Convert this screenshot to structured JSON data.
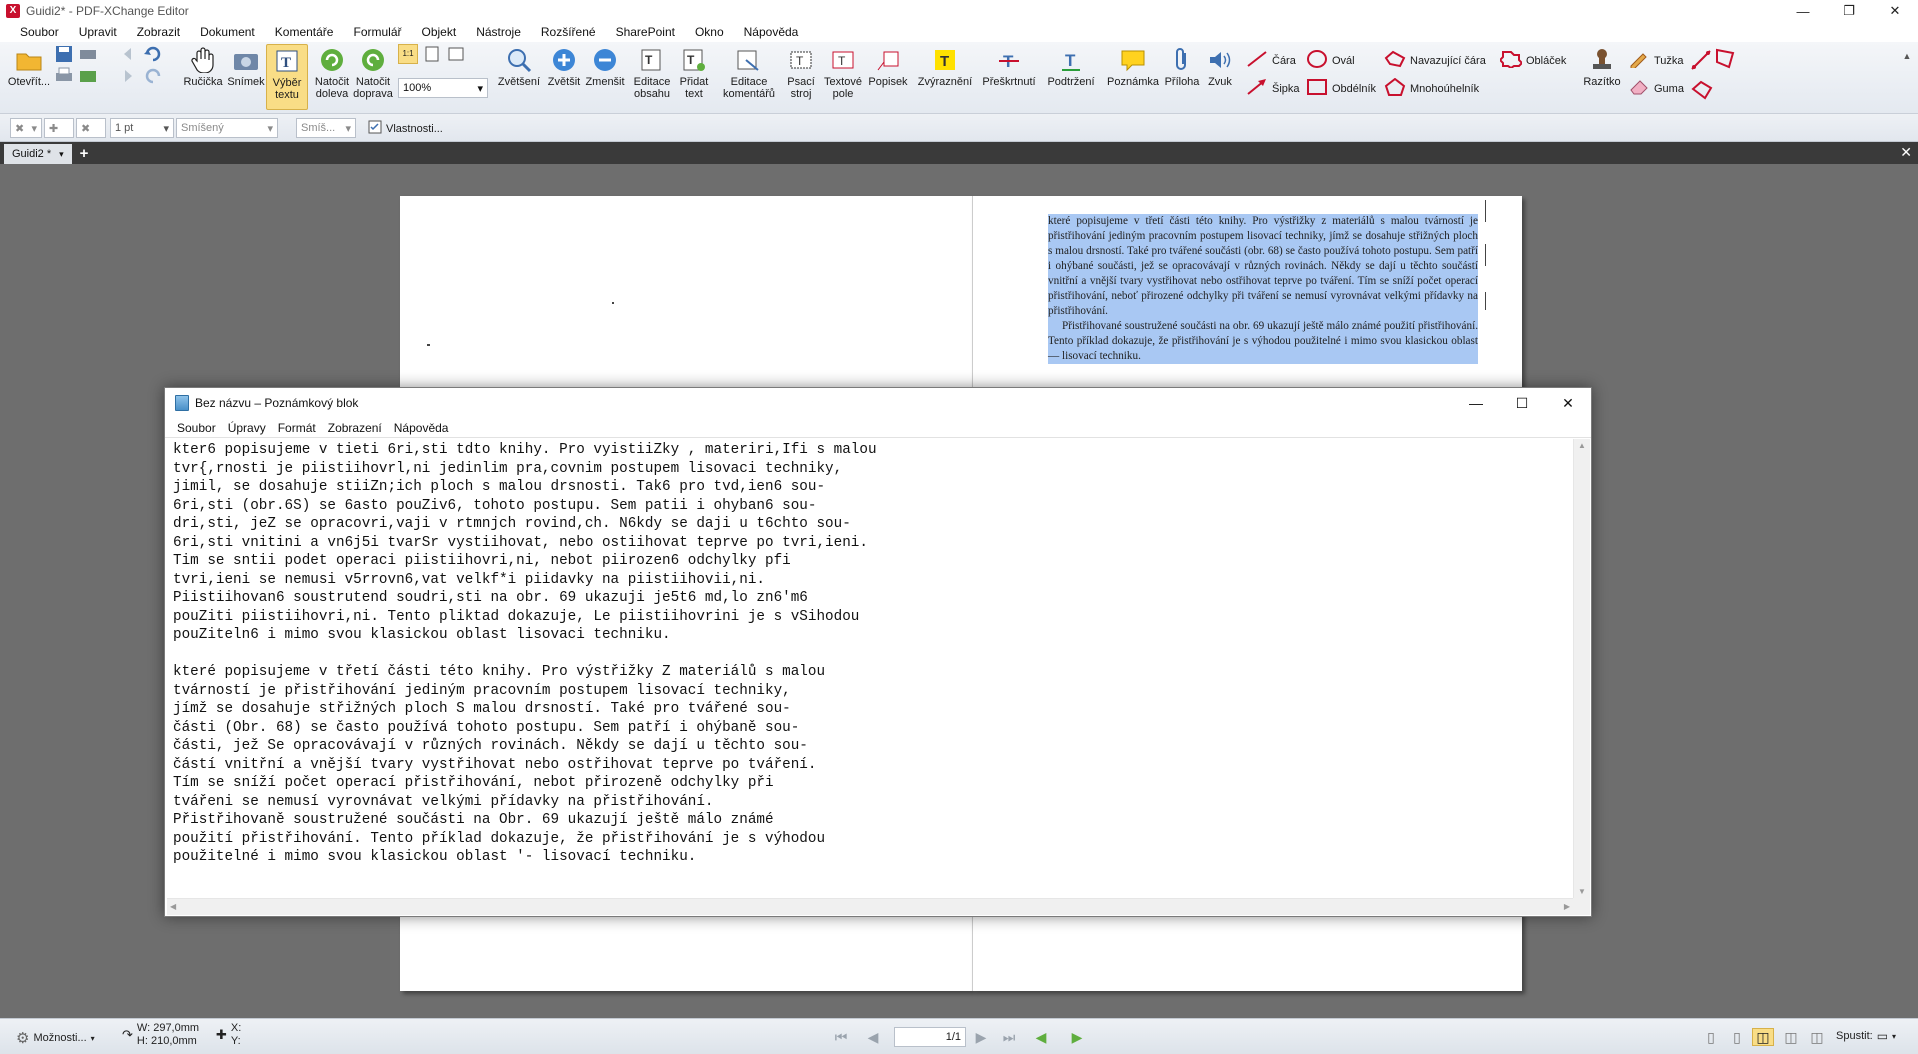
{
  "app": {
    "title": "Guidi2* - PDF-XChange Editor",
    "logo_letter": "X",
    "menu": [
      "Soubor",
      "Upravit",
      "Zobrazit",
      "Dokument",
      "Komentáře",
      "Formulář",
      "Objekt",
      "Nástroje",
      "Rozšířené",
      "SharePoint",
      "Okno",
      "Nápověda"
    ]
  },
  "toolbar": {
    "open": "Otevřít...",
    "hand": "Ručička",
    "snapshot": "Snímek",
    "select_text_1": "Výběr",
    "select_text_2": "textu",
    "rotate_left_1": "Natočit",
    "rotate_left_2": "doleva",
    "rotate_right_1": "Natočit",
    "rotate_right_2": "doprava",
    "zoom_value": "100%",
    "zoom_in": "Zvětšení",
    "enlarge": "Zvětšit",
    "shrink": "Zmenšit",
    "edit_content_1": "Editace",
    "edit_content_2": "obsahu",
    "add_text_1": "Přidat",
    "add_text_2": "text",
    "edit_comments_1": "Editace",
    "edit_comments_2": "komentářů",
    "typewriter_1": "Psací",
    "typewriter_2": "stroj",
    "text_box_1": "Textové",
    "text_box_2": "pole",
    "callout": "Popisek",
    "highlight": "Zvýraznění",
    "strikeout": "Přeškrtnutí",
    "underline": "Podtržení",
    "note": "Poznámka",
    "attachment": "Příloha",
    "sound": "Zvuk",
    "line": "Čára",
    "oval": "Ovál",
    "polyline": "Navazující čára",
    "cloud": "Obláček",
    "arrow": "Šipka",
    "rectangle": "Obdélník",
    "polygon": "Mnohoúhelník",
    "stamp": "Razítko",
    "pencil": "Tužka",
    "eraser": "Guma"
  },
  "toolbar2": {
    "line_width": "1 pt",
    "mixed": "Smíšený",
    "mixed2": "Smíš...",
    "properties": "Vlastnosti..."
  },
  "tabs": {
    "doc_tab": "Guidi2 *"
  },
  "pdf_page": {
    "paragraph1": "které popisujeme v třetí části této knihy. Pro výstřižky z materiálů s malou tvárností je přistřihování jediným pracovním postupem lisovací techniky, jímž se dosahuje střižných ploch s malou drsností. Také pro tvářené součásti (obr. 68) se často používá tohoto postupu. Sem patří i ohýbané součásti, jež se opracovávají v různých rovinách. Někdy se dají u těchto součástí vnitřní a vnější tvary vystřihovat nebo ostřihovat teprve po tváření. Tím se sníží počet operací přistřihování, neboť přirozené odchylky při tváření se nemusí vyrovnávat velkými přídavky na přistřihování.",
    "paragraph2": "Přistřihované soustružené součásti na obr. 69 ukazují ještě málo známé použití přistřihování. Tento příklad dokazuje, že přistřihování je s výhodou použitelné i mimo svou klasickou oblast — lisovací techniku."
  },
  "notepad": {
    "title": "Bez názvu – Poznámkový blok",
    "menu": [
      "Soubor",
      "Úpravy",
      "Formát",
      "Zobrazení",
      "Nápověda"
    ],
    "content": "kter6 popisujeme v tieti 6ri,sti tdto knihy. Pro vyistiiZky , materiri,Ifi s malou\ntvr{,rnosti je piistiihovrl,ni jedinlim pra,covnim postupem lisovaci techniky,\njimil, se dosahuje stiiZn;ich ploch s malou drsnosti. Tak6 pro tvd,ien6 sou-\n6ri,sti (obr.6S) se 6asto pouZiv6, tohoto postupu. Sem patii i ohyban6 sou-\ndri,sti, jeZ se opracovri,vaji v rtmnjch rovind,ch. N6kdy se daji u t6chto sou-\n6ri,sti vnitini a vn6j5i tvarSr vystiihovat, nebo ostiihovat teprve po tvri,ieni.\nTim se sntii podet operaci piistiihovri,ni, nebot piirozen6 odchylky pfi\ntvri,ieni se nemusi v5rrovn6,vat velkf*i piidavky na piistiihovii,ni.\nPiistiihovan6 soustrutend soudri,sti na obr. 69 ukazuji je5t6 md,lo zn6'm6\npouZiti piistiihovri,ni. Tento pliktad dokazuje, Le piistiihovrini je s vSihodou\npouZiteln6 i mimo svou klasickou oblast lisovaci techniku.\n\nkteré popisujeme v třetí části této knihy. Pro výstřižky Z materiálů s malou\ntvárností je přistřihování jediným pracovním postupem lisovací techniky,\njímž se dosahuje střižných ploch S malou drsností. Také pro tvářené sou-\nčásti (Obr. 68) se často používá tohoto postupu. Sem patří i ohýbaně sou-\nčásti, jež Se opracovávají v různých rovinách. Někdy se dají u těchto sou-\nčástí vnitřní a vnější tvary vystřihovat nebo ostřihovat teprve po tváření.\nTím se sníží počet operací přistřihování, nebot přirozeně odchylky při\ntvářeni se nemusí vyrovnávat velkými přídavky na přistřihování.\nPřistřihovaně soustružené součásti na Obr. 69 ukazují ještě málo známé\npoužití přistřihování. Tento příklad dokazuje, že přistřihování je s výhodou\npoužitelné i mimo svou klasickou oblast '- lisovací techniku."
  },
  "statusbar": {
    "options": "Možnosti...",
    "width": "W: 297,0mm",
    "height": "H: 210,0mm",
    "x": "X:",
    "y": "Y:",
    "page": "1/1",
    "run": "Spustit:"
  },
  "colors": {
    "selection": "#a9c8f3",
    "active_tool": "#f9dd86",
    "tabbar": "#3a3a3a",
    "workspace": "#6e6e6e"
  }
}
